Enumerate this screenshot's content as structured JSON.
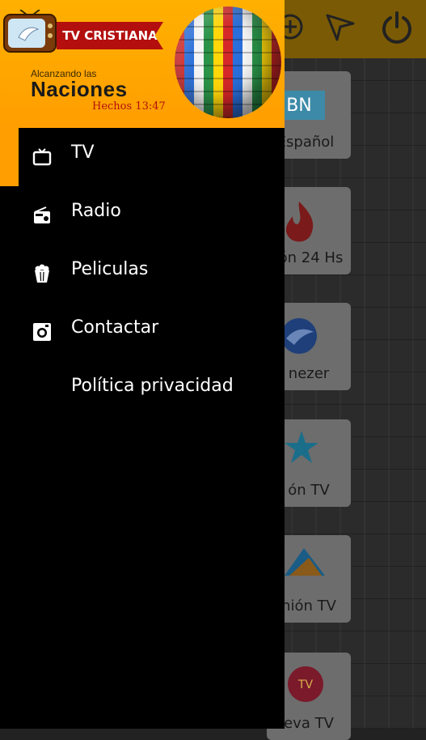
{
  "header": {
    "brand_ribbon": "TV CRISTIANA",
    "tagline_small": "Alcanzando las",
    "tagline_big": "Naciones",
    "verse": "Hechos 13:47"
  },
  "menu": [
    {
      "label": "TV",
      "icon": "tv-icon",
      "active": true
    },
    {
      "label": "Radio",
      "icon": "radio-icon",
      "active": false
    },
    {
      "label": "Peliculas",
      "icon": "popcorn-icon",
      "active": false
    },
    {
      "label": "Contactar",
      "icon": "camera-icon",
      "active": false
    },
    {
      "label": "Política privacidad",
      "icon": "",
      "active": false
    }
  ],
  "channels": [
    {
      "label": "Español",
      "logo": "BN"
    },
    {
      "label": "ión 24 Hs",
      "logo": "flame"
    },
    {
      "label": "nezer",
      "logo": "bird"
    },
    {
      "label": "ón TV",
      "logo": "star"
    },
    {
      "label": "nión TV",
      "logo": "arrow"
    },
    {
      "label": "eva TV",
      "logo": "nueva"
    }
  ],
  "colors": {
    "accent": "#ff9e00",
    "ribbon": "#b30f0f",
    "drawer_bg": "#000000"
  }
}
